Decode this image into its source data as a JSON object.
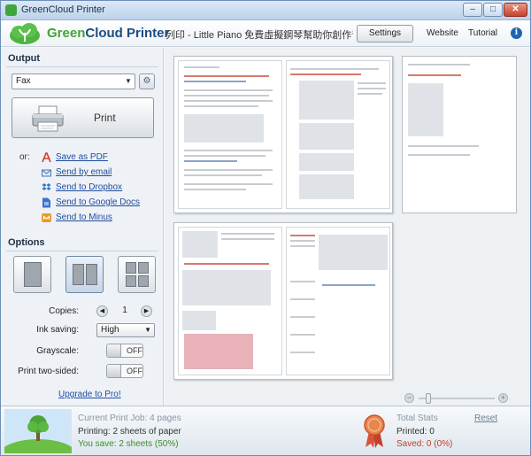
{
  "window": {
    "title": "GreenCloud Printer",
    "controls": {
      "minimize": "–",
      "maximize": "□",
      "close": "✕"
    }
  },
  "header": {
    "brand_green": "Green",
    "brand_rest": "Cloud Printer",
    "doc_title": "列印 - Little Piano 免費虛擬鋼琴幫助你創作音樂",
    "settings_label": "Settings",
    "website_label": "Website",
    "tutorial_label": "Tutorial",
    "info_glyph": "i"
  },
  "output": {
    "section_title": "Output",
    "printer_value": "Fax",
    "print_label": "Print",
    "or_label": "or:",
    "share": [
      {
        "label": "Save as PDF",
        "icon": "pdf-icon",
        "color": "#d23a2c"
      },
      {
        "label": "Send by email",
        "icon": "email-icon",
        "color": "#4a76b8"
      },
      {
        "label": "Send to Dropbox",
        "icon": "dropbox-icon",
        "color": "#2f78c8"
      },
      {
        "label": "Send to Google Docs",
        "icon": "google-docs-icon",
        "color": "#3a73d0"
      },
      {
        "label": "Send to Minus",
        "icon": "minus-icon",
        "color": "#e89a2a"
      }
    ]
  },
  "options": {
    "section_title": "Options",
    "layouts": [
      "1 page per sheet",
      "2 pages per sheet",
      "4 pages per sheet"
    ],
    "copies_label": "Copies:",
    "copies_value": "1",
    "ink_label": "Ink saving:",
    "ink_value": "High",
    "grayscale_label": "Grayscale:",
    "grayscale_value": "OFF",
    "twosided_label": "Print two-sided:",
    "twosided_value": "OFF",
    "upgrade_label": "Upgrade to Pro!"
  },
  "status": {
    "job_label": "Current Print Job: 4 pages",
    "printing_label": "Printing: 2 sheets of paper",
    "save_label": "You save: 2 sheets (50%)",
    "total_label": "Total Stats",
    "reset_label": "Reset",
    "printed_label": "Printed: 0",
    "saved_label": "Saved: 0 (0%)"
  },
  "colors": {
    "brand_green": "#43a336",
    "brand_blue": "#1b4d80",
    "link_blue": "#1f4da0"
  }
}
